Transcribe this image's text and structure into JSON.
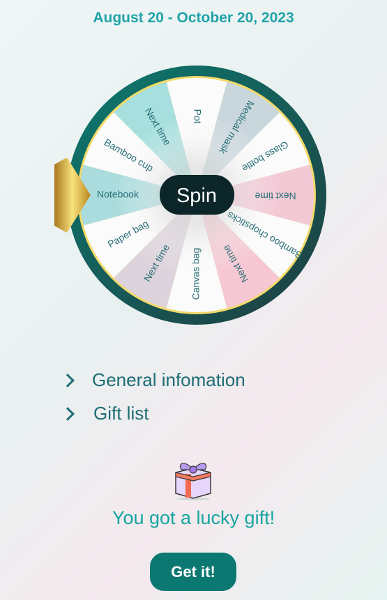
{
  "header": {
    "date_range": "August 20 - October 20, 2023"
  },
  "wheel": {
    "spin_label": "Spin",
    "segments": [
      {
        "label": "Pot",
        "color": "#fbfbfb"
      },
      {
        "label": "Medical mask",
        "color": "#c9d7dd"
      },
      {
        "label": "Glass bottle",
        "color": "#fbfbfb"
      },
      {
        "label": "Next time",
        "color": "#f2c9d5"
      },
      {
        "label": "Bamboo chopsticks",
        "color": "#fbfbfb"
      },
      {
        "label": "Next time",
        "color": "#f6c8d3"
      },
      {
        "label": "Canvas bag",
        "color": "#fbfbfb"
      },
      {
        "label": "Next time",
        "color": "#ddd3dc"
      },
      {
        "label": "Paper bag",
        "color": "#fbfbfb"
      },
      {
        "label": "Notebook",
        "color": "#aadcdd"
      },
      {
        "label": "Bamboo cup",
        "color": "#fbfbfb"
      },
      {
        "label": "Next time",
        "color": "#a6dfdd"
      }
    ],
    "ring_color": "#0e6e68",
    "gold_color": "#e9c54a",
    "text_color": "#2a6f78"
  },
  "sections": [
    {
      "label": "General infomation"
    },
    {
      "label": "Gift list"
    }
  ],
  "result": {
    "message": "You got a lucky gift!",
    "button": "Get it!"
  }
}
